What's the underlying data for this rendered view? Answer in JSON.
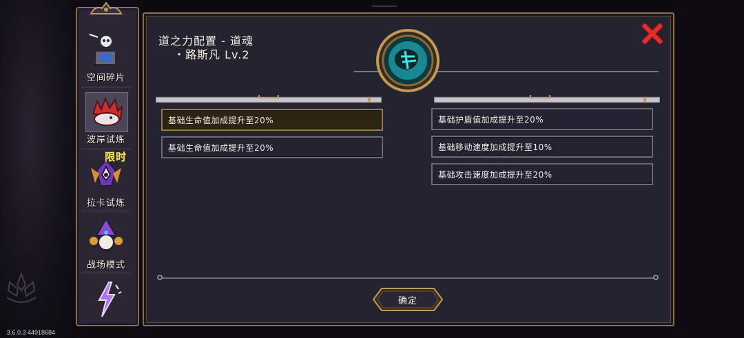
{
  "version": "3.6.0.3 44918684",
  "sidebar": {
    "tabs": [
      {
        "label": "空间碎片",
        "icon": "space-fragment-icon"
      },
      {
        "label": "波岸试炼",
        "icon": "red-creature-icon",
        "active": true
      },
      {
        "label": "拉卡试炼",
        "icon": "raka-trial-icon"
      },
      {
        "label": "战场模式",
        "icon": "battlefield-wizard-icon"
      },
      {
        "label": "",
        "icon": "lightning-icon"
      }
    ],
    "limited_badge": "限时"
  },
  "dialog": {
    "title_line1": "道之力配置 - 道魂",
    "title_line2": "・路斯凡 Lv.2",
    "left_stats": [
      "基础生命值加成提升至20%",
      "基础生命值加成提升至20%"
    ],
    "right_stats": [
      "基础护盾值加成提升至20%",
      "基础移动速度加成提升至10%",
      "基础攻击速度加成提升至20%"
    ],
    "confirm_label": "确定"
  },
  "colors": {
    "frame_gold": "#8a7048",
    "panel_bg": "#262331",
    "close_red": "#e03030",
    "emblem_teal": "#28c8c8"
  }
}
